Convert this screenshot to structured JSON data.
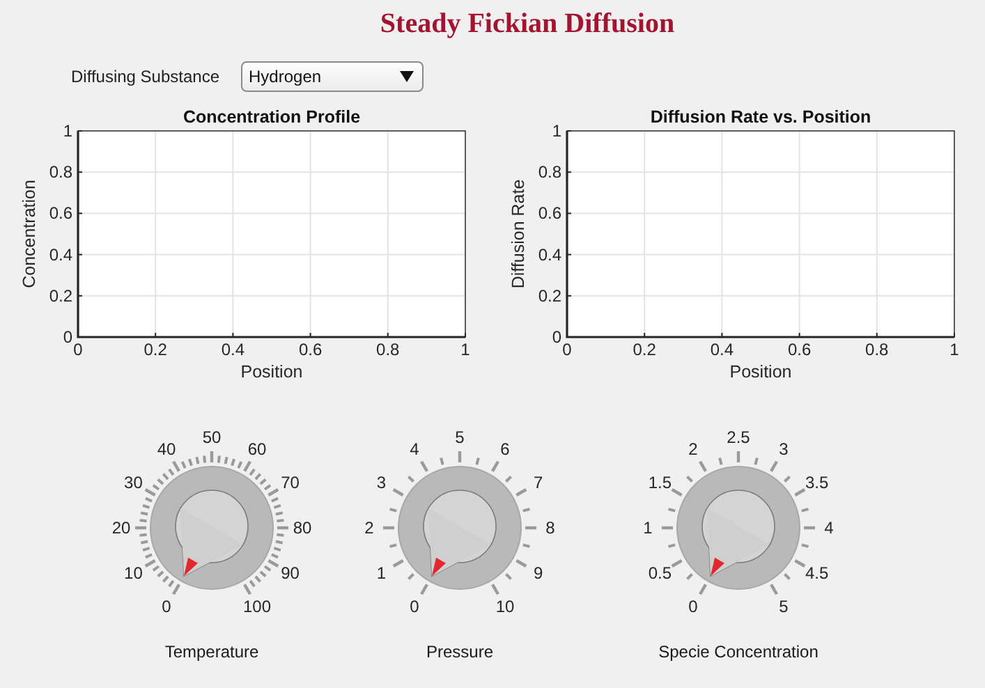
{
  "title": "Steady Fickian Diffusion",
  "substance": {
    "label": "Diffusing Substance",
    "value": "Hydrogen"
  },
  "plots": [
    {
      "chart_data": {
        "type": "line",
        "grid": true,
        "title": "Concentration Profile",
        "xlabel": "Position",
        "ylabel": "Concentration",
        "xlim": [
          0,
          1
        ],
        "ylim": [
          0,
          1
        ],
        "xticks": [
          0,
          0.2,
          0.4,
          0.6,
          0.8,
          1
        ],
        "yticks": [
          0,
          0.2,
          0.4,
          0.6,
          0.8,
          1
        ]
      }
    },
    {
      "chart_data": {
        "type": "line",
        "grid": true,
        "title": "Diffusion Rate vs. Position",
        "xlabel": "Position",
        "ylabel": "Diffusion Rate",
        "xlim": [
          0,
          1
        ],
        "ylim": [
          0,
          1
        ],
        "xticks": [
          0,
          0.2,
          0.4,
          0.6,
          0.8,
          1
        ],
        "yticks": [
          0,
          0.2,
          0.4,
          0.6,
          0.8,
          1
        ]
      }
    }
  ],
  "knobs": [
    {
      "label": "Temperature",
      "kind": "fine",
      "scale_labels": [
        "0",
        "10",
        "20",
        "30",
        "40",
        "50",
        "60",
        "70",
        "80",
        "90",
        "100"
      ]
    },
    {
      "label": "Pressure",
      "kind": "coarse",
      "scale_labels": [
        "0",
        "1",
        "2",
        "3",
        "4",
        "5",
        "6",
        "7",
        "8",
        "9",
        "10"
      ]
    },
    {
      "label": "Specie Concentration",
      "kind": "coarse",
      "scale_labels": [
        "0",
        "0.5",
        "1",
        "1.5",
        "2",
        "2.5",
        "3",
        "3.5",
        "4",
        "4.5",
        "5"
      ]
    }
  ]
}
